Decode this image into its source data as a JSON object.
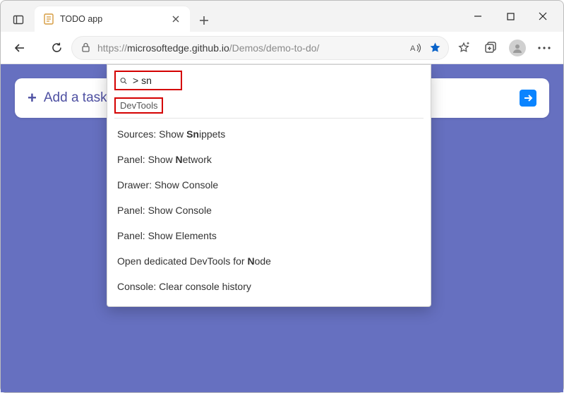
{
  "window": {
    "tab_title": "TODO app"
  },
  "toolbar": {
    "url_muted_prefix": "https://",
    "url_host": "microsoftedge.github.io",
    "url_muted_path": "/Demos/demo-to-do/"
  },
  "page": {
    "add_task_label": "Add a task"
  },
  "command_menu": {
    "query": "> sn",
    "section_label": "DevTools",
    "items": [
      {
        "text": "Sources: Show Snippets",
        "bold": "Sn"
      },
      {
        "text": "Panel: Show Network",
        "bold": "N"
      },
      {
        "text": "Drawer: Show Console",
        "bold": ""
      },
      {
        "text": "Panel: Show Console",
        "bold": ""
      },
      {
        "text": "Panel: Show Elements",
        "bold": ""
      },
      {
        "text": "Open dedicated DevTools for Node",
        "bold": "N"
      },
      {
        "text": "Console: Clear console history",
        "bold": ""
      }
    ]
  }
}
